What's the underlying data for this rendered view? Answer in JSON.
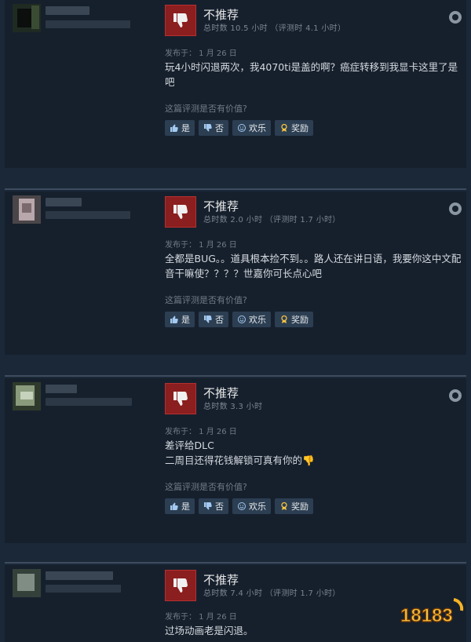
{
  "reviews": [
    {
      "verdict": "不推荐",
      "hours": "总时数 10.5 小时 （评测时 4.1 小时）",
      "date": "发布于： 1 月 26 日",
      "text": "玩4小时闪退两次，我4070ti是盖的啊？癌症转移到我显卡这里了是吧",
      "helpful_q": "这篇评测是否有价值?",
      "btn_yes": "是",
      "btn_no": "否",
      "btn_funny": "欢乐",
      "btn_award": "奖励"
    },
    {
      "verdict": "不推荐",
      "hours": "总时数 2.0 小时 （评测时 1.7 小时）",
      "date": "发布于： 1 月 26 日",
      "text": "全都是BUG。。道具根本捡不到。。路人还在讲日语，我要你这中文配音干嘛使？？？？世嘉你可长点心吧",
      "helpful_q": "这篇评测是否有价值?",
      "btn_yes": "是",
      "btn_no": "否",
      "btn_funny": "欢乐",
      "btn_award": "奖励"
    },
    {
      "verdict": "不推荐",
      "hours": "总时数 3.3 小时",
      "date": "发布于： 1 月 26 日",
      "text": "差评给DLC\n二周目还得花钱解锁可真有你的👎",
      "helpful_q": "这篇评测是否有价值?",
      "btn_yes": "是",
      "btn_no": "否",
      "btn_funny": "欢乐",
      "btn_award": "奖励"
    },
    {
      "verdict": "不推荐",
      "hours": "总时数 7.4 小时 （评测时 1.7 小时）",
      "date": "发布于： 1 月 26 日",
      "text": "过场动画老是闪退。"
    }
  ],
  "watermark": {
    "text": "18183"
  },
  "colors": {
    "bg": "#1b2838",
    "card": "#16202d",
    "thumb": "#8b1e1e"
  }
}
